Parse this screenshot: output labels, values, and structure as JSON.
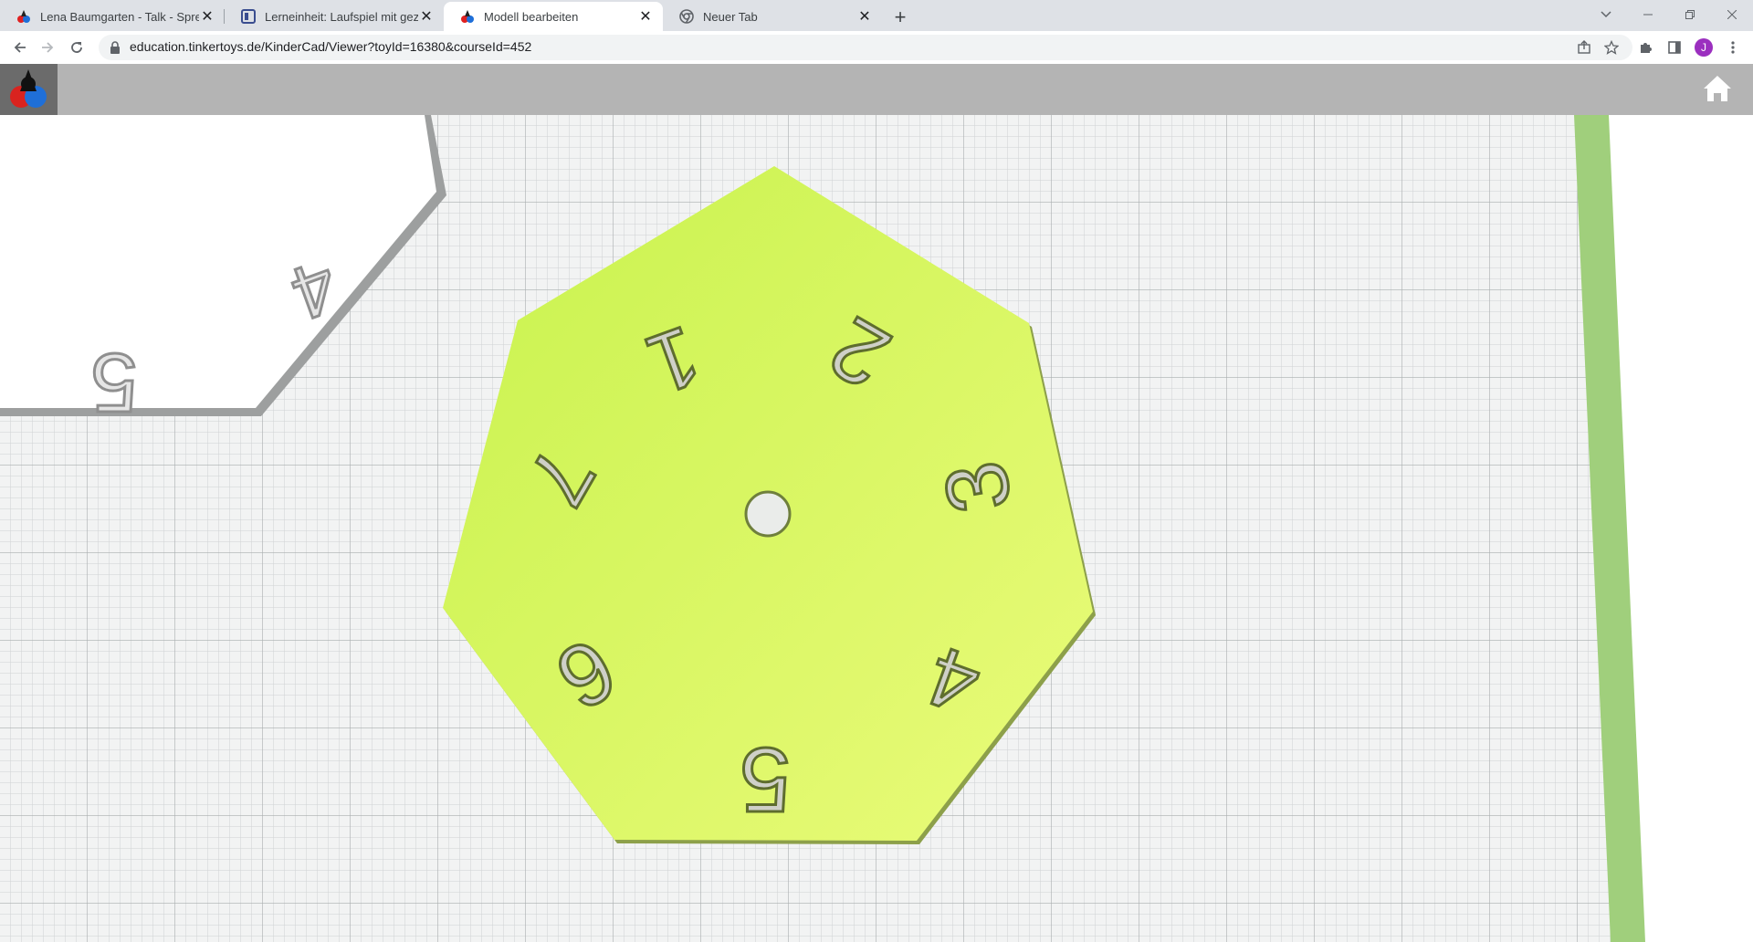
{
  "browser": {
    "tabs": [
      {
        "title": "Lena Baumgarten - Talk - Sprech",
        "active": false
      },
      {
        "title": "Lerneinheit: Laufspiel mit gezinkt",
        "active": false
      },
      {
        "title": "Modell bearbeiten",
        "active": true
      },
      {
        "title": "Neuer Tab",
        "active": false
      }
    ],
    "url": "education.tinkertoys.de/KinderCad/Viewer?toyId=16380&courseId=452",
    "profile_initial": "J",
    "profile_color": "#9b2fbf"
  },
  "viewer": {
    "main_plate": {
      "color": "#d4f55c",
      "numbers": [
        "1",
        "2",
        "3",
        "4",
        "5",
        "6",
        "7"
      ]
    },
    "partial_plate": {
      "color": "#ffffff",
      "numbers": [
        "4",
        "5"
      ]
    }
  }
}
